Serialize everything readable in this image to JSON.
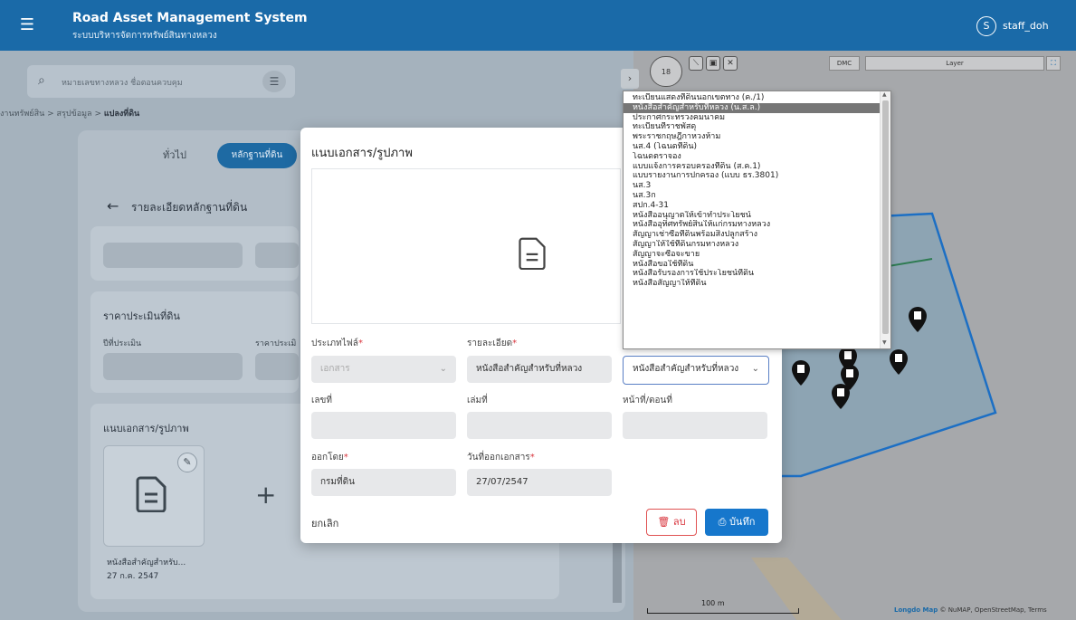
{
  "header": {
    "title": "Road Asset Management System",
    "subtitle": "ระบบบริหารจัดการทรัพย์สินทางหลวง",
    "user_initial": "S",
    "user_name": "staff_doh"
  },
  "search": {
    "placeholder": "หมายเลขทางหลวง ชื่อตอนควบคุม"
  },
  "breadcrumb": {
    "item1": "งานทรัพย์สิน",
    "item2": "สรุปข้อมูล",
    "item3": "แปลงที่ดิน",
    "sep": ">"
  },
  "tabs": {
    "general": "ทั่วไป",
    "evidence": "หลักฐานที่ดิน"
  },
  "detail": {
    "title": "รายละเอียดหลักฐานที่ดิน",
    "price_section": "ราคาประเมินที่ดิน",
    "assess_year": "ปีที่ประเมิน",
    "assess_price": "ราคาประเมิ",
    "attach_section": "แนบเอกสาร/รูปภาพ",
    "thumb_caption": "หนังสือสำคัญสำหรับ...",
    "thumb_date": "27 ก.ค. 2547"
  },
  "modal": {
    "title": "แนบเอกสาร/รูปภาพ",
    "file_type_label": "ประเภทไฟล์",
    "file_type_value": "เอกสาร",
    "detail_label": "รายละเอียด",
    "detail_value": "หนังสือสำคัญสำหรับที่หลวง",
    "doc_type_value": "หนังสือสำคัญสำหรับที่หลวง",
    "number_label": "เลขที่",
    "volume_label": "เล่มที่",
    "page_label": "หน้าที่/ตอนที่",
    "issued_by_label": "ออกโดย",
    "issued_by_value": "กรมที่ดิน",
    "issue_date_label": "วันที่ออกเอกสาร",
    "issue_date_value": "27/07/2547",
    "cancel_label": "ยกเลิก",
    "delete_label": "ลบ",
    "save_label": "บันทึก"
  },
  "dropdown_items": [
    "ทะเบียนแสดงที่ดินนอกเขตทาง (ค./1)",
    "หนังสือสำคัญสำหรับที่หลวง (น.ส.ล.)",
    "ประกาศกระทรวงคมนาคม",
    "ทะเบียนที่ราชพัสดุ",
    "พระราชกฤษฎีกาหวงห้าม",
    "นส.4 (โฉนดที่ดิน)",
    "โฉนดตราจอง",
    "แบบแจ้งการครอบครองที่ดิน (ส.ค.1)",
    "แบบรายงานการปกครอง (แบบ ธร.3801)",
    "นส.3",
    "นส.3ก",
    "สปก.4-31",
    "หนังสืออนุญาตให้เข้าทำประโยชน์",
    "หนังสืออุทิศทรัพย์สินให้แก่กรมทางหลวง",
    "สัญญาเช่าซื้อที่ดินพร้อมสิ่งปลูกสร้าง",
    "สัญญาให้ใช้ที่ดินกรมทางหลวง",
    "สัญญาจะซื้อจะขาย",
    "หนังสือขอใช้ที่ดิน",
    "หนังสือรับรองการใช้ประโยชน์ที่ดิน",
    "หนังสือสัญญาให้ที่ดิน"
  ],
  "dropdown_selected_index": 1,
  "map": {
    "zoom": "18",
    "dmc_label": "DMC",
    "layer_label": "Layer",
    "scale_label": "100 m",
    "attribution_brand": "Longdo Map",
    "attribution_text": "© NuMAP, OpenStreetMap, Terms"
  },
  "colors": {
    "header": "#1a6aa8",
    "primary": "#1677cc",
    "danger": "#d9363e",
    "parcel_fill": "#8da4b3",
    "parcel_border": "#1c6fc4"
  }
}
